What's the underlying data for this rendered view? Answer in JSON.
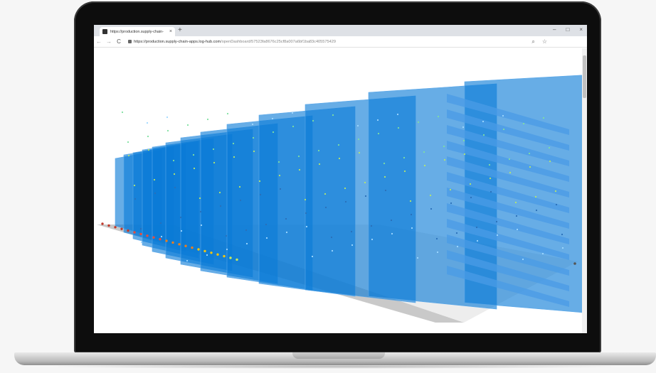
{
  "browser": {
    "tab_title": "https://production.supply-chain-",
    "tab_close": "×",
    "new_tab": "+",
    "window_controls": [
      "–",
      "□",
      "×"
    ],
    "nav": {
      "back": "←",
      "forward": "→",
      "reload": "C"
    },
    "url_host": "https://production.supply-chain-apps.log-hub.com",
    "url_path": "/openDashboard/57523fa8676c25cf8a007a6bf1ba83c405575429",
    "toolbar_icons": [
      "zoom-icon",
      "star-icon"
    ]
  },
  "colors": {
    "accent_blue": "#0a7bd6",
    "floor": "#c9c9c9",
    "laptop_bezel": "#0d0d0d"
  }
}
